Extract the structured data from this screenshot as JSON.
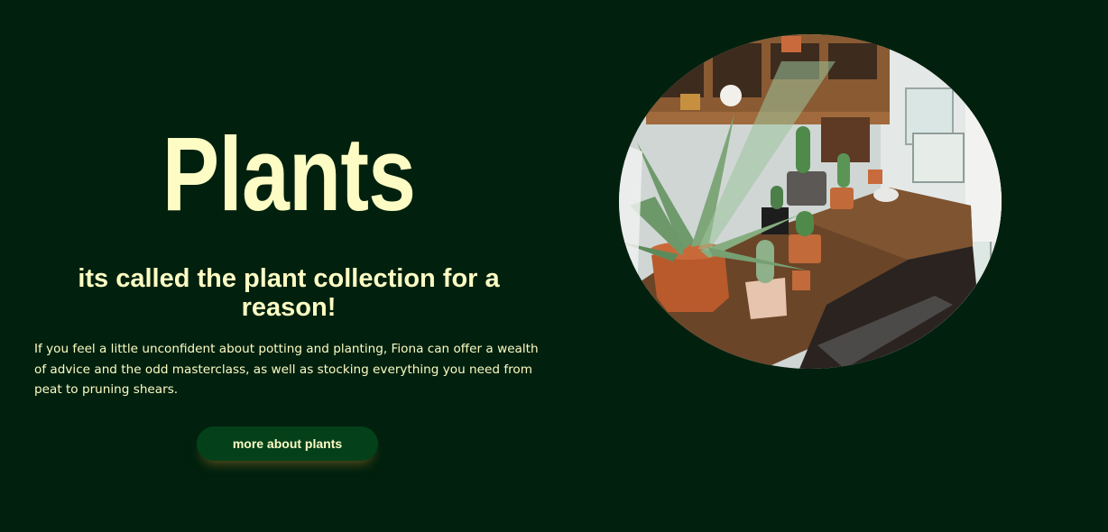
{
  "hero": {
    "title": "Plants",
    "subtitle": "its called the plant collection for a reason!",
    "description": "If you feel a little unconfident about potting and planting, Fiona can offer a wealth of advice and the odd masterclass, as well as stocking everything you need from peat to pruning shears.",
    "cta_label": "more about plants"
  },
  "image": {
    "subject": "potted cacti and succulents on a rustic wooden workbench"
  },
  "colors": {
    "background": "#01210e",
    "text_accent": "#fdfcc4",
    "button_bg": "#04411b",
    "button_glow": "#a67328"
  }
}
